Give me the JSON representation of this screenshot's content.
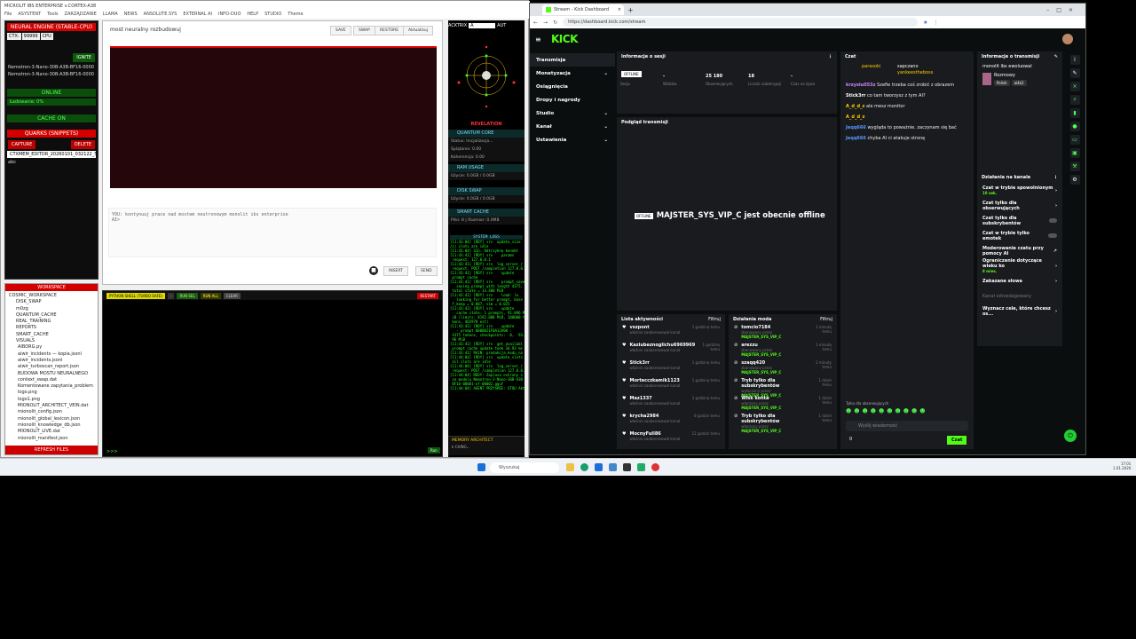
{
  "app": {
    "title": "MICROLIT IBS ENTERPRISE v.CORTEX-A38",
    "menu": [
      "File",
      "ASYSTENT",
      "Tools",
      "ZARZĄDZANIE",
      "LLAMA",
      "NEWS",
      "ANSOLUTE.SYS",
      "EXTERNAL AI",
      "INFO-DUO",
      "HELP",
      "STUDIO",
      "Theme"
    ],
    "engine_header": "NEURAL ENGINE (STABLE-CPU)",
    "ctx_label": "CTX:",
    "ctx_value": "99999",
    "cpu_label": "CPU",
    "ignite_label": "IGNITE",
    "models": [
      "Nemotron-3-Nano-30B-A3B-BF16-0000",
      "Nemotron-3-Nano-30B-A3B-BF16-0000"
    ],
    "online": "ONLINE",
    "loading": "Ładowanie: 0%",
    "cache_on": "CACHE ON",
    "quarks_header": "QUARKS (SNIPPETS)",
    "capture": "CAPTURE",
    "delete": "DELETE",
    "ctxmem": "CTXMEM_EDITOR_20260101_032122_50",
    "abc": "abc",
    "workspace_header": "WORKSPACE",
    "tree": [
      "COSMIC_WORKSPACE",
      "DISK_SWAP",
      "m0zg",
      "QUANTUM_CACHE",
      "REAL_TRAINING",
      "REPORTS",
      "SMART_CACHE",
      "VISUALS",
      "AIBORG.py",
      "aiwir_incidents — kopia.jsonl",
      "aiwir_incidents.jsonl",
      "aiwir_turboscan_report.json",
      "BUDOWA MOSTU NEURALNEGO",
      "context_swap.dat",
      "Komentowane zapytania_problem",
      "logo.png",
      "logo1.png",
      "MIONOLIT_ARCHITECT_VEIN.dat",
      "mionolit_config.json",
      "mionolit_global_lexicon.json",
      "mionolit_knowledge_db.json",
      "MIONOLIT_LIVE.dat",
      "mionolit_manifest.json"
    ],
    "refresh": "REFRESH FILES",
    "editor_title": "most neuralny rozbudowuj",
    "editor_btns": [
      "SAVE",
      "SWAP",
      "RESTORE",
      "Aktualizuj"
    ],
    "prompt_text": "YOU: kontynuuj prace nad mostem neutronowym monolit ibs enterprise\nAI>",
    "insert_label": "INSERT",
    "send_label": "SEND",
    "terminal_btns": [
      "PYTHON SHELL (TURBO SAFE)",
      "-",
      "RUN SEL",
      "RUN ALL",
      "CLEAR"
    ],
    "restart_label": "RESTART",
    "term_prompt": ">>>",
    "run_label": "Run"
  },
  "mid": {
    "actrix_label": "ACKTRIX",
    "actrix_value": "A",
    "auto_label": "AUT",
    "revelation": "REVELATION",
    "quantum_header": "QUANTUM CORE",
    "quantum_lines": [
      "Status: Inicjalizacja...",
      "Splątanie: 0.00",
      "Koherencja: 0.00"
    ],
    "ram_header": "RAM USAGE",
    "ram_line": "Użycie: 0.0GB / 0.0GB",
    "disk_header": "DISK SWAP",
    "disk_line": "Użycie: 0.0GB / 0.0GB",
    "smart_header": "SMART CACHE",
    "smart_line": "Pliki: 8 | Rozmiar: 0.0MB",
    "logs_header": "SYSTEM LOGS",
    "logs": "[11:43:04] [RDY] srv  update_size\n/s) slots are idle\n[11:43:04] SIG: Odtrzyknę konekt\n[11:43:41] [RDY] srv    params\n request: 127.0.0.1\n[11:43:41] [RDY] srv  log_server_r\n request: POST /completion 127.0.0.1\n[11:43:41] [RDY] srv    update\n prompt cache\n[11:43:41] [RDY] srv    prompt_save\n   saving prompt with length 4375,\n total state = 33.488 MiB\n[11:43:41] [RDY] srv    load: lo\n   looking for better prompt, base\n f_keep = 0.007, sim = 0.025\n[11:43:41] [RDY] srv    update\n   cache state: 1 prompts, 91.096 M\n iB (limits: 8192.000 MiB, 100000 to\n kens, 465978 est)\n[11:43:41] [RDY] srv    update\n   - prompt 0000021F0A12A00 :\n 4375 tokens, checkpoints:  0,  93.4\n 96 MiB\n[11:43:41] [RDY] srv  get_availabl\n prompt cache update took 34.93 ms\n[11:43:41] RAIN: produkcja_kodu_na\n[11:44:04] [RDY] srv  update_slots\n all slots are idle\n[11:44:04] [RDY] srv  log_server_r\n request: POST /completion 127.0.0.1\n[11:44:04] REDY: Zaplusa ochrony s\n ze modelu Nemotron-3-Nano-30B-A3B\n BF16-00001-of-00002.gguf\n[11:44:04] AGENT PRZYSMIE: GTOU Aktyw",
    "memory_header": "MEMORY ARCHITECT",
    "memory_line": "Ł-CHING..."
  },
  "browser": {
    "tab_title": "Stream - Kick Dashboard",
    "url": "https://dashboard.kick.com/stream",
    "logo": "KICK",
    "nav": [
      {
        "label": "Transmisja",
        "active": true,
        "chevron": false
      },
      {
        "label": "Monetyzacja",
        "active": false,
        "chevron": true
      },
      {
        "label": "Osiągnięcia",
        "active": false,
        "chevron": false
      },
      {
        "label": "Dropy i nagrody",
        "active": false,
        "chevron": false
      },
      {
        "label": "Studio",
        "active": false,
        "chevron": true
      },
      {
        "label": "Kanał",
        "active": false,
        "chevron": true
      },
      {
        "label": "Ustawienia",
        "active": false,
        "chevron": true
      }
    ],
    "session": {
      "title": "Informacje o sesji",
      "badge": "OFFLINE",
      "stats": [
        {
          "value": "",
          "label": "Sesja"
        },
        {
          "value": "-",
          "label": "Widzów"
        },
        {
          "value": "25 180",
          "label": "Obserwujących"
        },
        {
          "value": "18",
          "label": "Licznik subskrypcji"
        },
        {
          "value": "-",
          "label": "Czas na żywo"
        }
      ]
    },
    "preview": {
      "title": "Podgląd transmisji",
      "badge": "OFFLINE",
      "text": "MAJSTER_SYS_VIP_C jest obecnie offline"
    },
    "activity": {
      "title": "Lista aktywności",
      "filter": "Filtruj",
      "items": [
        {
          "name": "vszpont",
          "sub": "właśnie zaobserwował kanał",
          "time": "1 godzinę temu"
        },
        {
          "name": "Kaziubeznoglichu6969969",
          "sub": "właśnie zaobserwował kanał",
          "time": "1 godzinę temu"
        },
        {
          "name": "Stick3rr",
          "sub": "właśnie zaobserwował kanał",
          "time": "1 godzinę temu"
        },
        {
          "name": "Mortecczkamik1123",
          "sub": "właśnie zaobserwował kanał",
          "time": "1 godzinę temu"
        },
        {
          "name": "Maz1337",
          "sub": "właśnie zaobserwował kanał",
          "time": "1 godzinę temu"
        },
        {
          "name": "krycha2984",
          "sub": "właśnie zaobserwował kanał",
          "time": "8 godzin temu"
        },
        {
          "name": "MocnyFull86",
          "sub": "właśnie zaobserwował kanał",
          "time": "12 godzin temu"
        }
      ]
    },
    "mod": {
      "title": "Działania moda",
      "filter": "Filtruj",
      "items": [
        {
          "name": "tomcio7184",
          "sub": "zbanowany przez",
          "who": "MAJSTER_SYS_VIP_C",
          "time": "1 minutę temu"
        },
        {
          "name": "arezzu",
          "sub": "zbanowany przez",
          "who": "MAJSTER_SYS_VIP_C",
          "time": "1 minutę temu"
        },
        {
          "name": "szaqq420",
          "sub": "zbanowany przez",
          "who": "MAJSTER_SYS_VIP_C",
          "time": "2 minuty temu"
        },
        {
          "name": "Tryb tylko dla subskrybentów",
          "sub": "wyłączony przez",
          "who": "MAJSTER_SYS_VIP_C",
          "time": "1 dzień temu"
        },
        {
          "name": "Wisk konta",
          "sub": "włączony przez",
          "who": "MAJSTER_SYS_VIP_C",
          "time": "1 dzień temu"
        },
        {
          "name": "Tryb tylko dla subskrybentów",
          "sub": "włączony przez",
          "who": "MAJSTER_SYS_VIP_C",
          "time": "1 dzień temu"
        }
      ]
    },
    "chat": {
      "title": "Czat",
      "pinned_user1": "parasoki",
      "pinned_user2": "sapczano",
      "pinned_user3": "yankeestheboss",
      "messages": [
        {
          "user": "krzysiu053z",
          "text": "Szefie trzeba coś zrobić z obrazem"
        },
        {
          "user": "Stick3rr",
          "text": "co tam tworzysz z tym AI?"
        },
        {
          "user": "A_d_d_z",
          "text": "ale mesz monitor"
        },
        {
          "user": "A_d_d_z",
          "text": ""
        },
        {
          "user": "Jeqq666",
          "text": "wygląda to poważnie. zaczynam się bać"
        },
        {
          "user": "Jeqq666",
          "text": "chyba AI ci atakuje stronę"
        }
      ],
      "followers_only": "Tylko dla obserwujących",
      "placeholder": "Wyślij wiadomość",
      "count": "0",
      "send": "Czat"
    },
    "stream_info": {
      "title": "Informacje o transmisji",
      "name": "monolit ibs ewoluowal",
      "category": "Rozmowy",
      "tags": [
        "Polish",
        "ai4k2"
      ]
    },
    "channel": {
      "title": "Działania na kanale",
      "items": [
        {
          "label": "Czat w trybie spowolnionym",
          "sub": "10 sek.",
          "control": "chevron"
        },
        {
          "label": "Czat tylko dla obserwujących",
          "sub": "",
          "control": "chevron"
        },
        {
          "label": "Czat tylko dla subskrybentów",
          "sub": "",
          "control": "toggle"
        },
        {
          "label": "Czat w trybie tylko emotek",
          "sub": "",
          "control": "toggle"
        },
        {
          "label": "Moderowanie czatu przy pomocy AI",
          "sub": "",
          "control": "ext"
        },
        {
          "label": "Ograniczenie dotyczące wieku ko",
          "sub": "8 mies.",
          "control": "chevron"
        },
        {
          "label": "Zakazane słowa",
          "sub": "",
          "control": "chevron"
        },
        {
          "label": "Kanał odrzedagowany",
          "sub": "",
          "control": "none"
        },
        {
          "label": "Wyznacz cele, które chcesz os...",
          "sub": "",
          "control": "chevron"
        }
      ]
    }
  },
  "taskbar": {
    "search": "Wyszukaj",
    "time": "17:01",
    "date": "1.01.2026"
  },
  "colors": {
    "kick_green": "#53fc18",
    "red": "#d40000",
    "dark": "#0b0e0f"
  }
}
